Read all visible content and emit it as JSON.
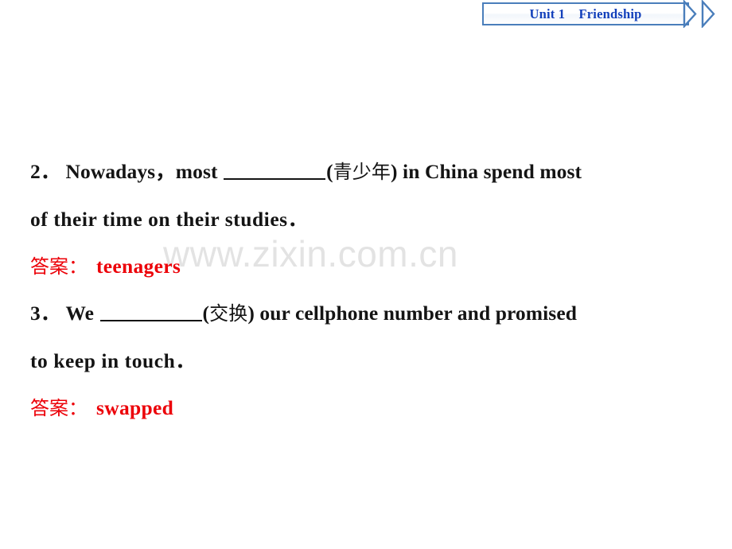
{
  "header": {
    "unit_label": "Unit 1",
    "unit_title": "Friendship",
    "banner_text": "Unit 1    Friendship",
    "border_color": "#4a7ebb",
    "text_color": "#1340bb",
    "chevron_icon": "double-chevron-right-icon"
  },
  "watermark": {
    "text": "www.zixin.com.cn",
    "color": "#e3e3e3"
  },
  "colors": {
    "answer_red": "#ec0008",
    "body_black": "#141414",
    "banner_blue": "#1340bb",
    "banner_border": "#4a7ebb"
  },
  "exercises": [
    {
      "number": "2．",
      "lines": [
        {
          "segments": [
            {
              "type": "text",
              "value": "Nowadays，most "
            },
            {
              "type": "blank"
            },
            {
              "type": "text",
              "value": "("
            },
            {
              "type": "cn",
              "value": "青少年"
            },
            {
              "type": "text",
              "value": ") in China spend most"
            }
          ]
        },
        {
          "segments": [
            {
              "type": "text",
              "value": "of their time on their studies．"
            }
          ]
        }
      ],
      "answer_label": "答案：",
      "answer_value": "teenagers"
    },
    {
      "number": "3．",
      "lines": [
        {
          "segments": [
            {
              "type": "text",
              "value": "We "
            },
            {
              "type": "blank"
            },
            {
              "type": "text",
              "value": "("
            },
            {
              "type": "cn",
              "value": "交换"
            },
            {
              "type": "text",
              "value": ") our cellphone number and promised"
            }
          ]
        },
        {
          "segments": [
            {
              "type": "text",
              "value": "to keep in touch．"
            }
          ]
        }
      ],
      "answer_label": "答案：",
      "answer_value": "swapped"
    }
  ]
}
